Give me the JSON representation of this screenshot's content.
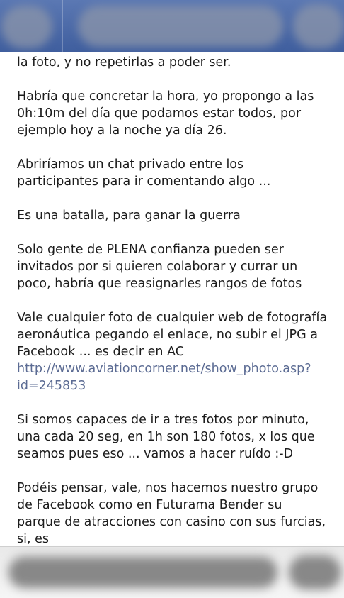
{
  "header": {
    "left_icon": "blurred-avatar-icon",
    "title_icon": "blurred-title",
    "right_icon": "blurred-profile-icon"
  },
  "post": {
    "lines": {
      "p1": "la foto, y no repetirlas a poder ser.",
      "p2": "Habría que concretar la hora, yo propongo a las 0h:10m del día que podamos estar todos, por ejemplo hoy a la noche ya día 26.",
      "p3": "Abriríamos un chat privado entre los participantes para ir comentando algo ...",
      "p4": "Es una batalla, para ganar la guerra",
      "p5": "Solo gente de PLENA confianza pueden ser invitados por si quieren colaborar y currar un poco, habría que reasignarles rangos de fotos",
      "p6_text": "Vale cualquier foto de cualquier web de fotografía aeronáutica pegando el enlace, no subir el JPG a Facebook ... es decir en AC ",
      "p6_link": "http://www.aviationcorner.net/show_photo.asp?id=245853",
      "p7": "Si somos capaces de ir a tres fotos por minuto, una cada 20 seg, en 1h son 180 fotos, x los que seamos pues eso ... vamos a hacer ruído :-D",
      "p8": "Podéis pensar, vale, nos hacemos nuestro grupo de Facebook como en Futurama Bender su parque de atracciones con casino con sus furcias, si, es"
    },
    "link_color": "#5b6b93",
    "text_color": "#1c1c1c"
  },
  "footer": {
    "input_icon": "blurred-message-input",
    "send_icon": "blurred-send-button"
  },
  "colors": {
    "header_bg": "#4a6aa8",
    "footer_bg": "#efefef"
  }
}
